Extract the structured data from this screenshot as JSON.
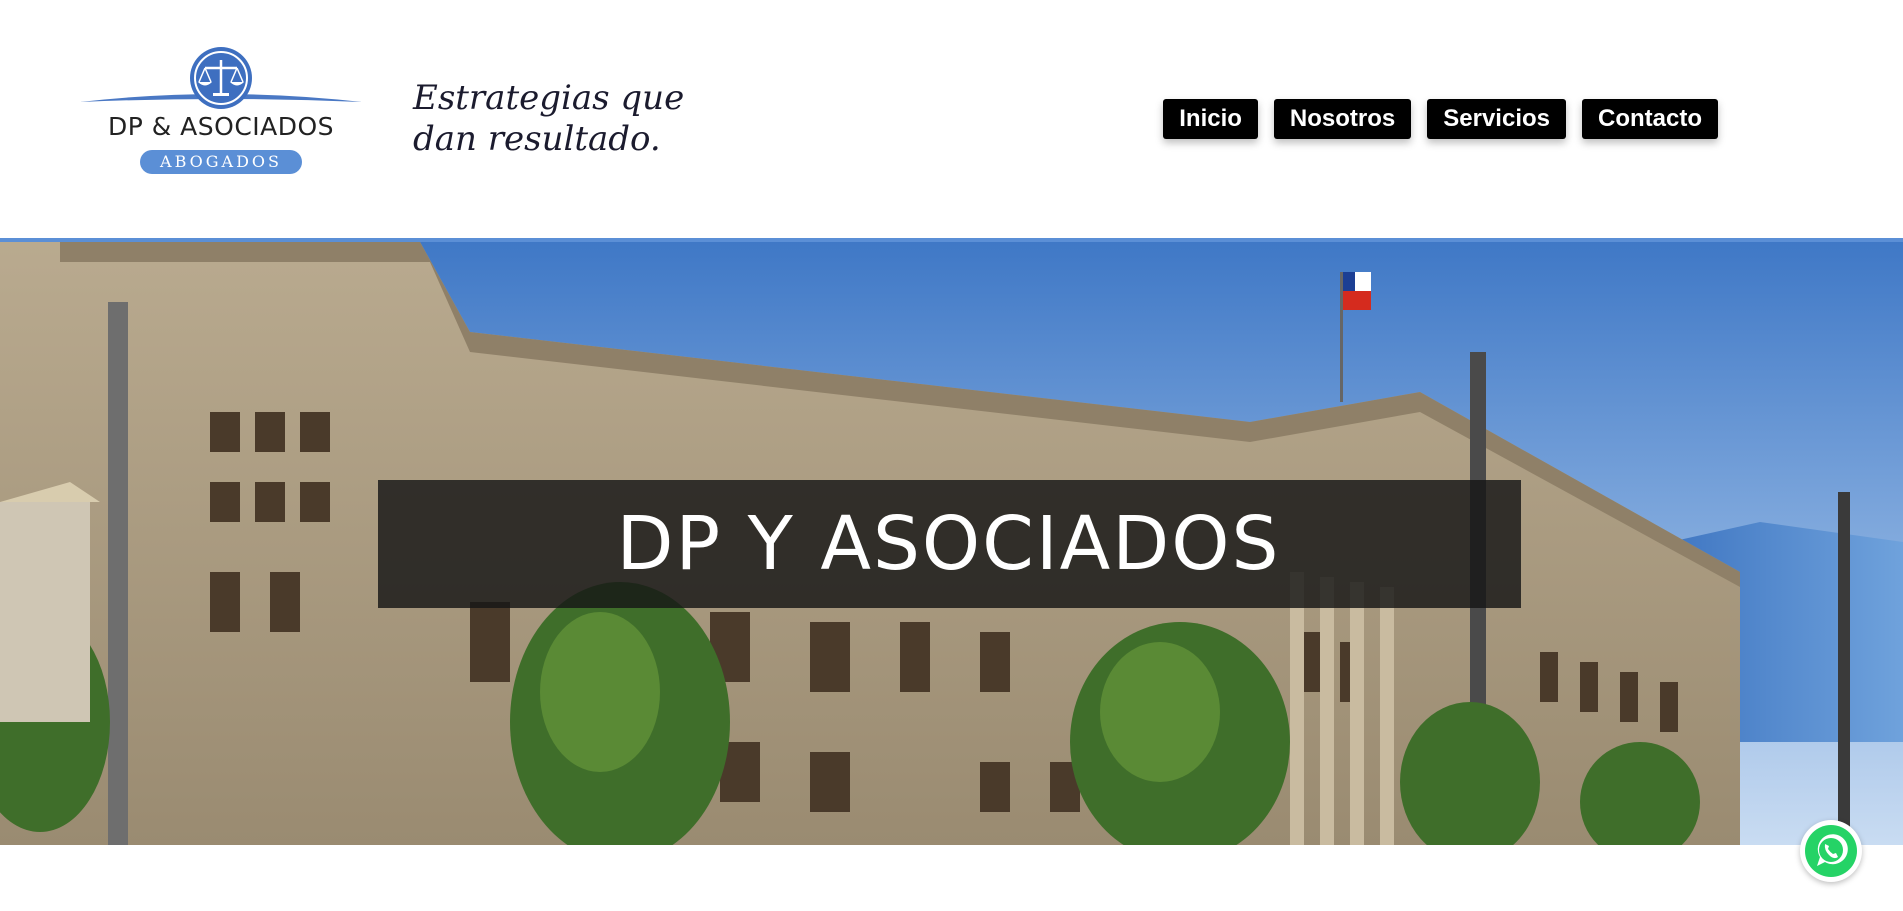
{
  "logo": {
    "name": "DP & ASOCIADOS",
    "sub": "ABOGADOS"
  },
  "tagline": "Estrategias que dan resultado.",
  "nav": {
    "items": [
      {
        "label": "Inicio"
      },
      {
        "label": "Nosotros"
      },
      {
        "label": "Servicios"
      },
      {
        "label": "Contacto"
      }
    ]
  },
  "hero": {
    "title": "DP Y ASOCIADOS"
  },
  "colors": {
    "accent": "#5b8fd6",
    "nav_bg": "#000000",
    "whatsapp": "#25d366"
  },
  "icons": {
    "logo_emblem": "scales-of-justice-icon",
    "floating_button": "whatsapp-icon"
  }
}
